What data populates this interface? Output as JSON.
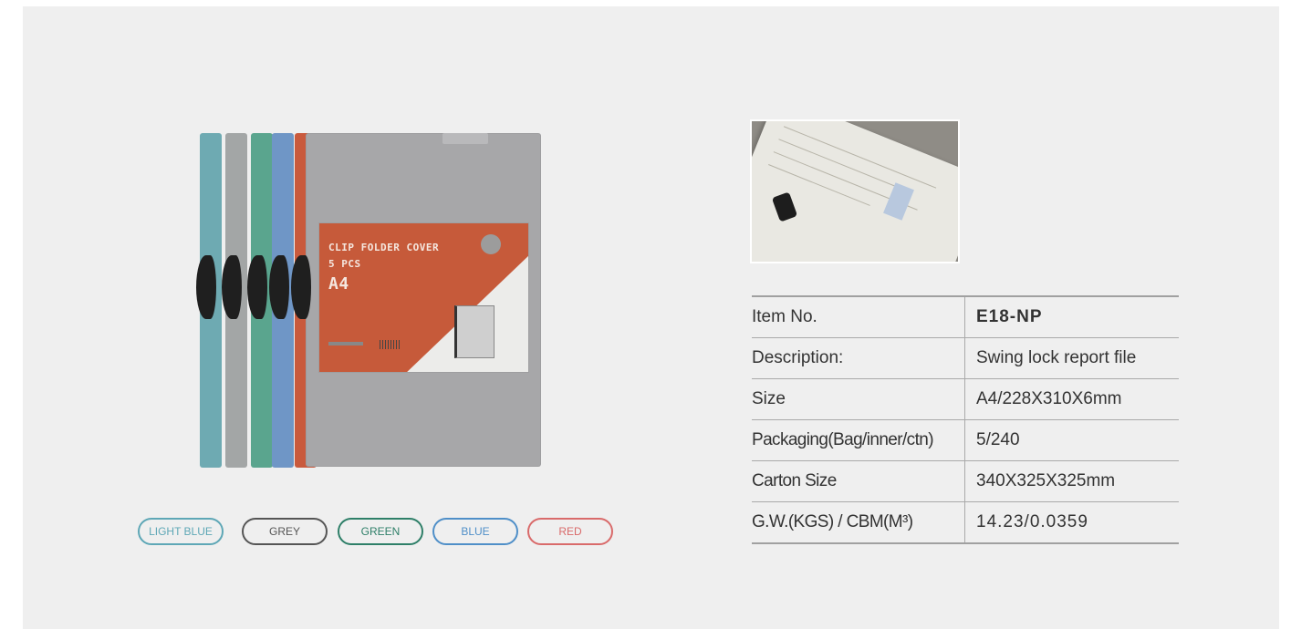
{
  "product_label": {
    "line1": "CLIP FOLDER COVER",
    "line2": "5 PCS",
    "line3": "A4"
  },
  "colors": [
    {
      "label": "LIGHT BLUE",
      "hex": "#5ea7b6"
    },
    {
      "label": "GREY",
      "hex": "#555555"
    },
    {
      "label": "GREEN",
      "hex": "#2e7f68"
    },
    {
      "label": "BLUE",
      "hex": "#4f8fc8"
    },
    {
      "label": "RED",
      "hex": "#d96a6a"
    }
  ],
  "stripe_colors": [
    "#6eaab2",
    "#a3a6a6",
    "#5aa58e",
    "#6f96c6",
    "#c95a3d"
  ],
  "specs": [
    {
      "key": "Item No.",
      "value": "E18-NP"
    },
    {
      "key": "Description:",
      "value": "Swing lock report file"
    },
    {
      "key": "Size",
      "value": "A4/228X310X6mm"
    },
    {
      "key": "Packaging(Bag/inner/ctn)",
      "value": "5/240"
    },
    {
      "key": "Carton Size",
      "value": "340X325X325mm"
    },
    {
      "key": "G.W.(KGS) / CBM(M³)",
      "value": "14.23/0.0359"
    }
  ]
}
